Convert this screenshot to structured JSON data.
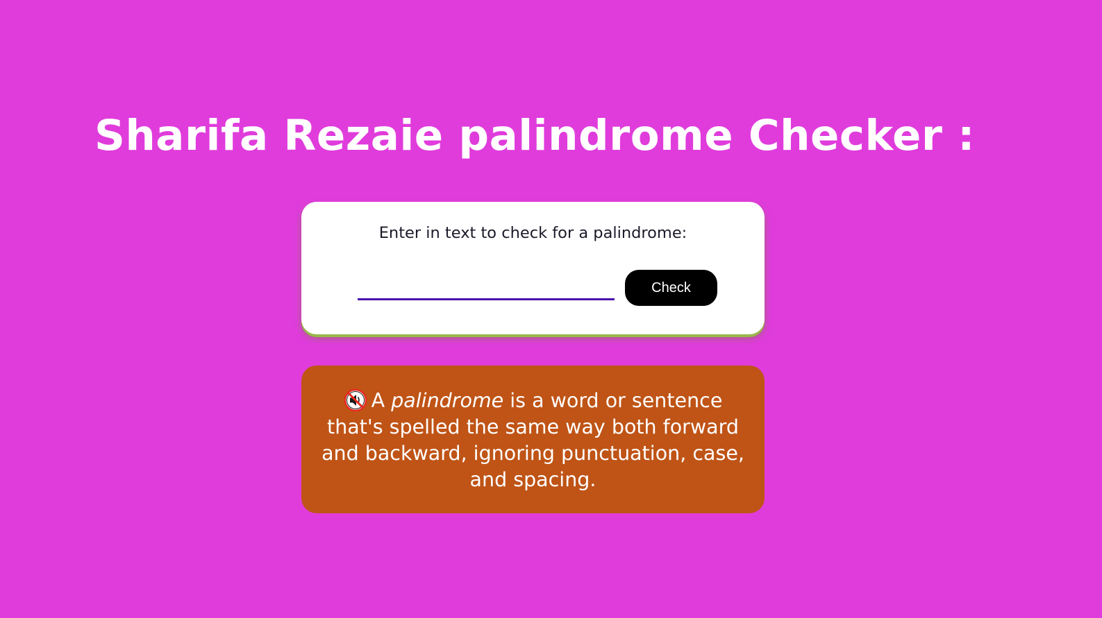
{
  "page": {
    "title": "Sharifa Rezaie palindrome Checker :"
  },
  "checker": {
    "prompt": "Enter in text to check for a palindrome:",
    "input_value": "",
    "input_placeholder": "",
    "button_label": "Check"
  },
  "info": {
    "icon": "muted-speaker-icon",
    "lead": "A",
    "term": "palindrome",
    "definition": "is a word or sentence that's spelled the same way both forward and backward, ignoring punctuation, case, and spacing."
  },
  "colors": {
    "background": "#e03cdc",
    "title_text": "#ffffff",
    "card_background": "#ffffff",
    "card_shadow": "#98b84a",
    "input_underline": "#4b0fae",
    "button_background": "#000000",
    "button_text": "#ffffff",
    "info_background": "#bf5416",
    "info_text": "#ffffff"
  }
}
